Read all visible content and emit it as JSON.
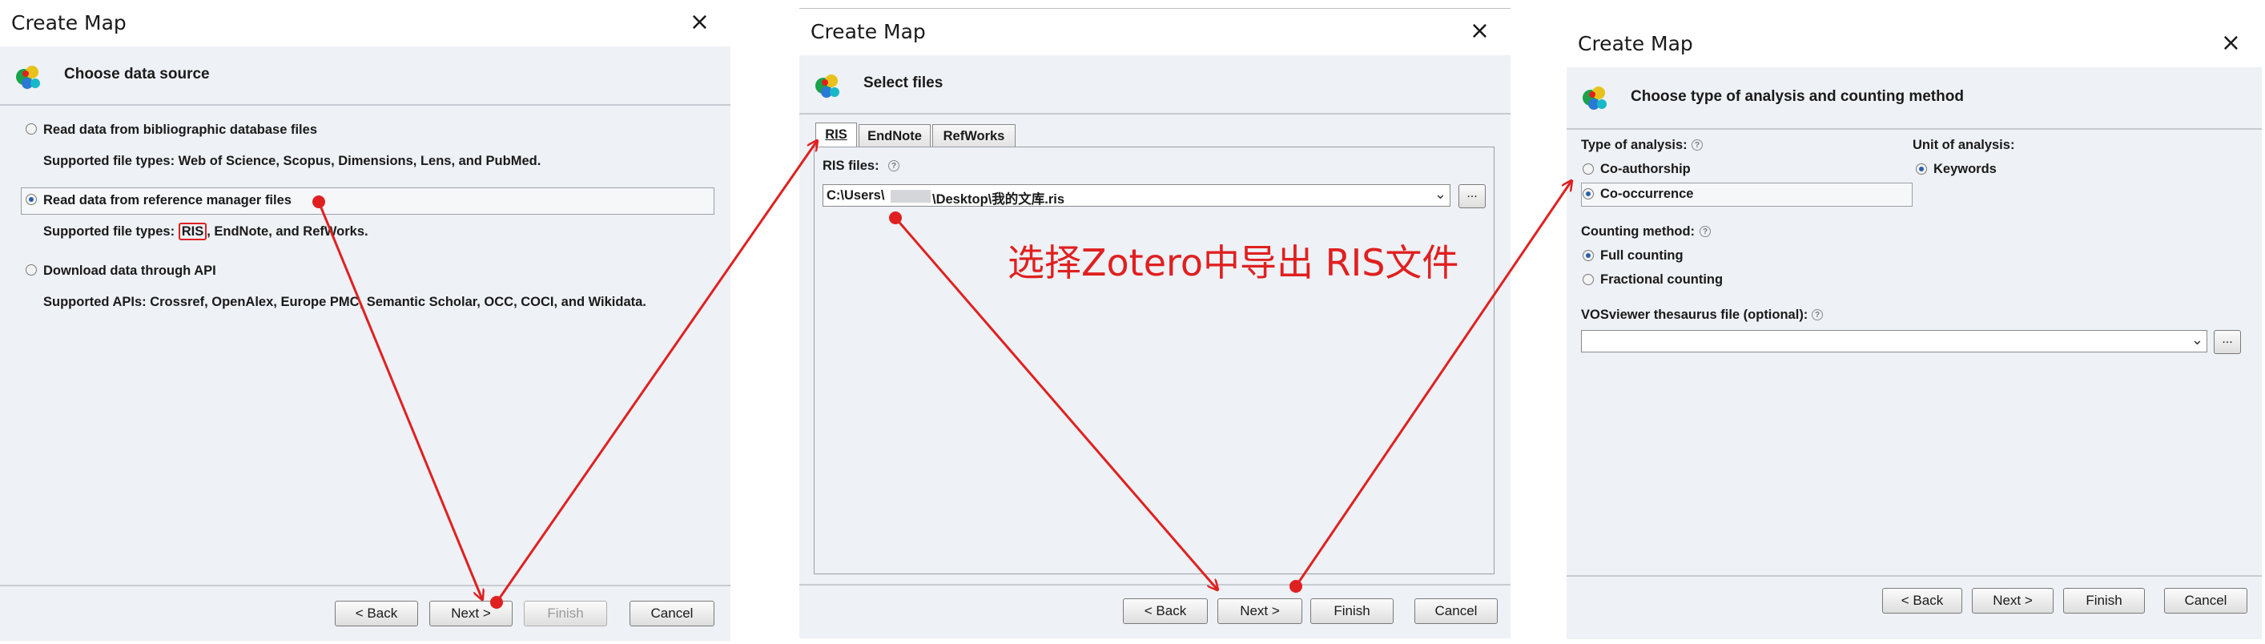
{
  "dialog1": {
    "title": "Create Map",
    "close": "×",
    "header": "Choose data source",
    "option1_label": "Read data from bibliographic database files",
    "option1_desc": "Supported file types: Web of Science, Scopus, Dimensions, Lens, and PubMed.",
    "option2_label": "Read data from reference manager files",
    "option2_desc_prefix": "Supported file types: ",
    "option2_desc_highlight": "RIS",
    "option2_desc_suffix": ", EndNote, and RefWorks.",
    "option3_label": "Download data through API",
    "option3_desc": "Supported APIs: Crossref, OpenAlex, Europe PMC, Semantic Scholar, OCC, COCI, and Wikidata.",
    "selected_option": 2,
    "buttons": {
      "back": "< Back",
      "next": "Next >",
      "finish": "Finish",
      "cancel": "Cancel"
    }
  },
  "dialog2": {
    "title": "Create Map",
    "close": "×",
    "header": "Select files",
    "tabs": [
      "RIS",
      "EndNote",
      "RefWorks"
    ],
    "active_tab": "RIS",
    "ris_files_label": "RIS files:",
    "ris_path_prefix": "C:\\Users\\",
    "ris_path_suffix": "\\Desktop\\我的文库.ris",
    "browse": "...",
    "buttons": {
      "back": "< Back",
      "next": "Next >",
      "finish": "Finish",
      "cancel": "Cancel"
    }
  },
  "dialog3": {
    "title": "Create Map",
    "close": "×",
    "header": "Choose type of analysis and counting method",
    "type_label": "Type of analysis:",
    "type_options": [
      "Co-authorship",
      "Co-occurrence"
    ],
    "type_selected": "Co-occurrence",
    "unit_label": "Unit of analysis:",
    "unit_options": [
      "Keywords"
    ],
    "counting_label": "Counting method:",
    "counting_options": [
      "Full counting",
      "Fractional counting"
    ],
    "counting_selected": "Full counting",
    "thesaurus_label": "VOSviewer thesaurus file (optional):",
    "browse": "...",
    "buttons": {
      "back": "< Back",
      "next": "Next >",
      "finish": "Finish",
      "cancel": "Cancel"
    }
  },
  "annotation": {
    "text": "选择Zotero中导出 RIS文件",
    "color": "#e02020"
  },
  "colors": {
    "panel": "#eef1f5",
    "accent_radio": "#2a5fa8",
    "annotation_red": "#e02020"
  }
}
